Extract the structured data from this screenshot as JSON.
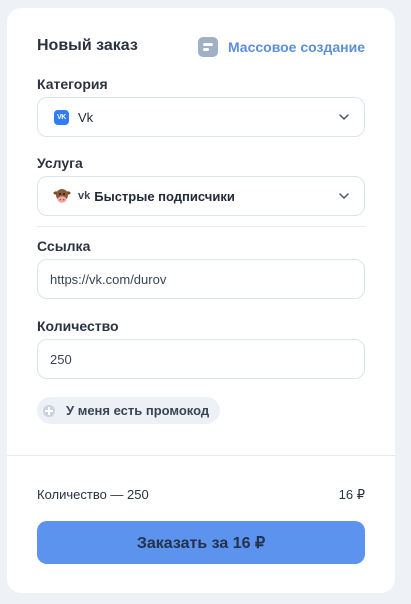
{
  "form": {
    "title": "Новый заказ",
    "mass_create_label": "Массовое создание",
    "mass_create_icon": "document-list-icon"
  },
  "category": {
    "label": "Категория",
    "value": "Vk",
    "icon_text": "VK",
    "icon": "vk-logo-icon",
    "accent": "#2f7cf6"
  },
  "service": {
    "label": "Услуга",
    "prefix": "vk",
    "value": "Быстрые подписчики",
    "icon": "cow-emoji-icon"
  },
  "link": {
    "label": "Ссылка",
    "value": "https://vk.com/durov"
  },
  "quantity": {
    "label": "Количество",
    "value": "250"
  },
  "promo": {
    "label": "У меня есть промокод",
    "icon": "plus-circle-icon"
  },
  "summary": {
    "quantity_text": "Количество — 250",
    "price": "16 ₽"
  },
  "order_button": {
    "label": "Заказать за 16 ₽",
    "color": "#5c93ee"
  }
}
